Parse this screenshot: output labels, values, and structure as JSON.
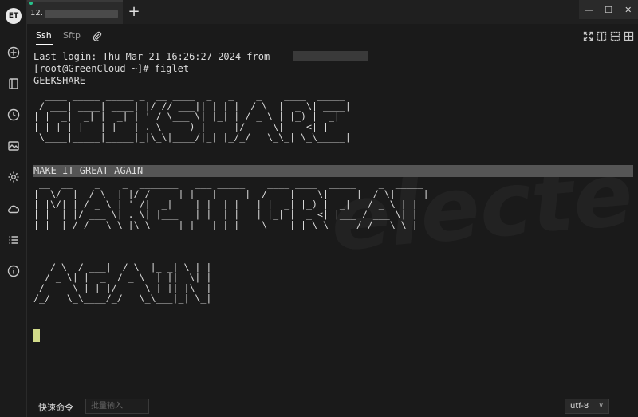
{
  "app": {
    "logo_text": "ET"
  },
  "tab": {
    "title": "12.",
    "new_tab": "+"
  },
  "window": {
    "minimize": "—",
    "maximize": "☐",
    "close": "✕"
  },
  "subtabs": {
    "ssh": "Ssh",
    "sftp": "Sftp"
  },
  "terminal": {
    "lines": {
      "login": "Last login: Thu Mar 21 16:26:27 2024 from",
      "prompt": "[root@GreenCloud ~]# figlet",
      "input1": "GEEKSHARE",
      "input2": "MAKE IT GREAT AGAIN"
    },
    "ascii_geekshare": "  ____ _____ _____ _  __ ____  _   _    _    ____  _____\n / ___| ____| ____| |/ // ___|| | | |  / \\  |  _ \\| ____|\n| |  _|  _| |  _| | ' / \\___ \\| |_| | / _ \\ | |_) |  _|\n| |_| | |___| |___| . \\  ___) |  _  |/ ___ \\|  _ <| |___\n \\____|_____|_____|_|\\_\\|____/|_| |_/_/   \\_\\_| \\_\\_____|",
    "ascii_make": " __  __    _    _  _______   ___ _____    ____ ____  _____    _  _____\n|  \\/  |  / \\  | |/ / ____| |_ _|_   _|  / ___|  _ \\| ____|  / \\|_   _|\n| |\\/| | / _ \\ | ' /|  _|    | |  | |   | |  _| |_) |  _|   / _ \\ | |\n| |  | |/ ___ \\| . \\| |___   | |  | |   | |_| |  _ <| |___ / ___ \\| |\n|_|  |_/_/   \\_\\_|\\_\\_____| |___| |_|    \\____|_| \\_\\_____/_/   \\_\\_|",
    "ascii_again": "    _    ____    _    ___ _   _\n   / \\  / ___|  / \\  |_ _| \\ | |\n  / _ \\| |  _  / _ \\  | ||  \\| |\n / ___ \\ |_| |/ ___ \\ | || |\\  |\n/_/   \\_\\____/_/   \\_\\___|_| \\_|"
  },
  "bottom": {
    "quick_label": "快速命令",
    "quick_placeholder": "批量输入",
    "encoding": "utf-8",
    "encoding_chevron": "∨"
  },
  "icons": {
    "sidebar": [
      "plus-circle-icon",
      "book-icon",
      "clock-icon",
      "image-icon",
      "gear-icon",
      "cloud-icon",
      "list-icon",
      "info-icon"
    ],
    "toolbar": [
      "paperclip-icon",
      "expand-icon",
      "split-horizontal-icon",
      "split-vertical-icon",
      "layout-icon"
    ]
  }
}
